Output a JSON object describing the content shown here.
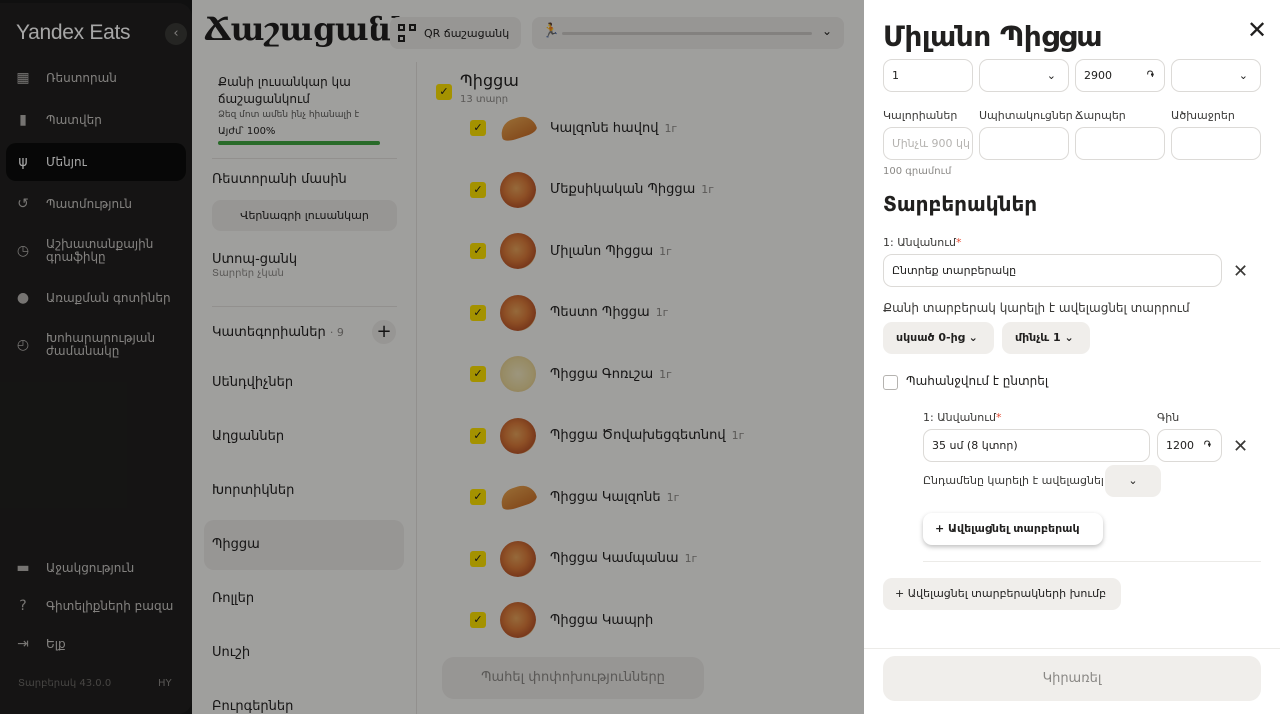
{
  "sidebar": {
    "brand": "Yandex Eats",
    "collapse_icon": "chevron-left-icon",
    "items": [
      {
        "label": "Ռեստորան",
        "icon": "restaurant-icon"
      },
      {
        "label": "Պատվեր",
        "icon": "order-icon"
      },
      {
        "label": "Մենյու",
        "icon": "menu-fork-knife-icon",
        "active": true
      },
      {
        "label": "Պատմություն",
        "icon": "history-icon"
      },
      {
        "label": "Աշխատանքային գրաֆիկը",
        "icon": "schedule-clock-icon"
      },
      {
        "label": "Առաքման գոտիներ",
        "icon": "location-pin-icon"
      },
      {
        "label": "Խոհարարության ժամանակը",
        "icon": "timer-icon"
      }
    ],
    "bottom_items": [
      {
        "label": "Աջակցություն",
        "icon": "chat-icon"
      },
      {
        "label": "Գիտելիքների բազա",
        "icon": "help-icon"
      },
      {
        "label": "Ելք",
        "icon": "logout-icon"
      }
    ],
    "version": "Տարբերակ 43.0.0",
    "lang": "HY"
  },
  "main": {
    "title": "Ճաշացանկ",
    "qr_button": "QR ճաշացանկ",
    "progress": {
      "title": "Քանի լուսանկար կա ճաշացանկում",
      "subtitle": "Ձեզ մոտ ամեն ինչ հիանալի է",
      "now_label": "Այժմ՝ 100%",
      "value": 100
    },
    "about_restaurant": "Ռեստորանի մասին",
    "reorder_photos_button": "Վերնագրի լուսանկար",
    "stop_list": {
      "title": "Ստոպ-ցանկ",
      "subtitle": "Տարրեր չկան"
    },
    "categories_title": "Կատեգորիաներ",
    "categories_count": "· 9",
    "categories": [
      "Սենդվիչներ",
      "Աղցաններ",
      "Խորտիկներ",
      "Պիցցա",
      "Ռոլլեր",
      "Սուշի",
      "Բուրգերներ"
    ],
    "active_category": "Պիցցա",
    "group": {
      "title": "Պիցցա",
      "count": "13 տարր"
    },
    "items": [
      {
        "name": "Կալզոնե հավով",
        "weight": "1г",
        "thumb": "calzone"
      },
      {
        "name": "Մեքսիկական Պիցցա",
        "weight": "1г",
        "thumb": "pizza"
      },
      {
        "name": "Միլանո Պիցցա",
        "weight": "1г",
        "thumb": "pizza"
      },
      {
        "name": "Պեստո Պիցցա",
        "weight": "1г",
        "thumb": "pizza"
      },
      {
        "name": "Պիցցա Գոռւշա",
        "weight": "1г",
        "thumb": "pale"
      },
      {
        "name": "Պիցցա Ծովախեցգետնով",
        "weight": "1г",
        "thumb": "pizza"
      },
      {
        "name": "Պիցցա Կալզոնե",
        "weight": "1г",
        "thumb": "calzone"
      },
      {
        "name": "Պիցցա Կամպանա",
        "weight": "1г",
        "thumb": "pizza"
      },
      {
        "name": "Պիցցա Կապրի",
        "weight": "",
        "thumb": "pizza"
      }
    ],
    "save_button": "Պահել փոփոխությունները"
  },
  "drawer": {
    "title": "Միլանո Պիցցա",
    "top_fields": {
      "amount": "1",
      "price": "2900",
      "currency": "֏"
    },
    "nutrition": {
      "labels": [
        "Կալորիաներ",
        "Սպիտակուցներ",
        "Ճարպեր",
        "Ածխաջրեր"
      ],
      "calories_placeholder": "Մինչև 900 կկալ",
      "hint": "100 գրամում"
    },
    "variants_title": "Տարբերակներ",
    "name_label": "1: Անվանում",
    "name_placeholder": "Ընտրեք տարբերակը",
    "how_many_question": "Քանի տարբերակ կարելի է ավելացնել տարրում",
    "from_pill": "սկսած 0-ից",
    "to_pill": "մինչև 1",
    "required_label": "Պահանջվում է ընտրել",
    "option": {
      "name_label": "1: Անվանում",
      "name_value": "35 սմ (8 կտոր)",
      "price_label": "Գին",
      "price_value": "1200",
      "currency": "֏",
      "total_label": "Ընդամենը կարելի է ավելացնել"
    },
    "add_variant_button": "Ավելացնել տարբերակ",
    "add_group_button": "Ավելացնել տարբերակների խումբ",
    "apply_button": "Կիրառել"
  }
}
